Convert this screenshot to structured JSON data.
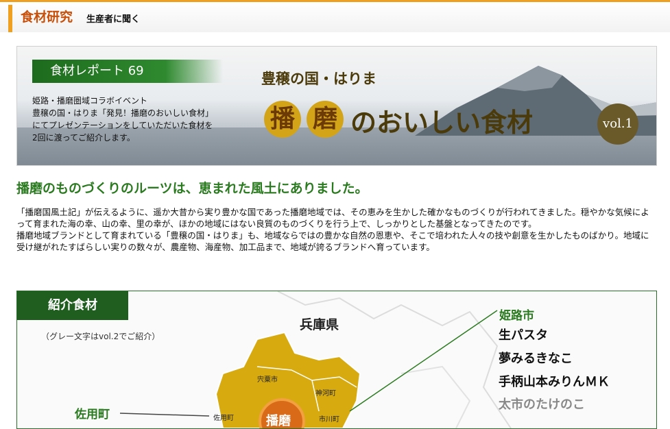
{
  "header": {
    "title": "食材研究",
    "subtitle": "生産者に聞く"
  },
  "banner": {
    "report_label": "食材レポート 69",
    "description": [
      "姫路・播磨圏域コラボイベント",
      "豊穣の国・はりま「発見！播磨のおいしい食材」",
      "にてプレゼンテーションをしていただいた食材を",
      "2回に渡ってご紹介します。"
    ],
    "tagline": "豊穣の国・はりま",
    "char1": "播",
    "char2": "磨",
    "title_rest": "のおいしい食材",
    "vol": "vol.1"
  },
  "headline": "播磨のものづくりのルーツは、恵まれた風土にありました。",
  "body": [
    "「播磨国風土記」が伝えるように、遥か大昔から実り豊かな国であった播磨地域では、その恵みを生かした確かなものづくりが行われてきました。穏やかな気候によって育まれた海の幸、山の幸、里の幸が、ほかの地域にはない良質のものづくりを行う上で、しっかりとした基盤となってきたのです。",
    "播磨地域ブランドとして育まれている「豊穣の国・はりま」も、地域ならではの豊かな自然の恩恵や、そこで培われた人々の技や創意を生かしたものばかり。地域に受け継がれたすばらしい実りの数々が、農産物、海産物、加工品まで、地域が誇るブランドへ育っています。"
  ],
  "map": {
    "section_label": "紹介食材",
    "note": "（グレー文字はvol.2でご紹介）",
    "prefecture": "兵庫県",
    "city": "姫路市",
    "items": [
      {
        "name": "生パスタ",
        "gray": false
      },
      {
        "name": "夢みるきなこ",
        "gray": false
      },
      {
        "name": "手柄山本みりんＭＫ",
        "gray": false
      },
      {
        "name": "太市のたけのこ",
        "gray": true
      }
    ],
    "town": "佐用町",
    "map_labels": [
      "宍粟市",
      "神河町",
      "佐用町",
      "市川町"
    ],
    "center_char": "播磨"
  },
  "colors": {
    "accent": "#f0a020",
    "green": "#2a7a1f",
    "gold": "#d4a418"
  }
}
